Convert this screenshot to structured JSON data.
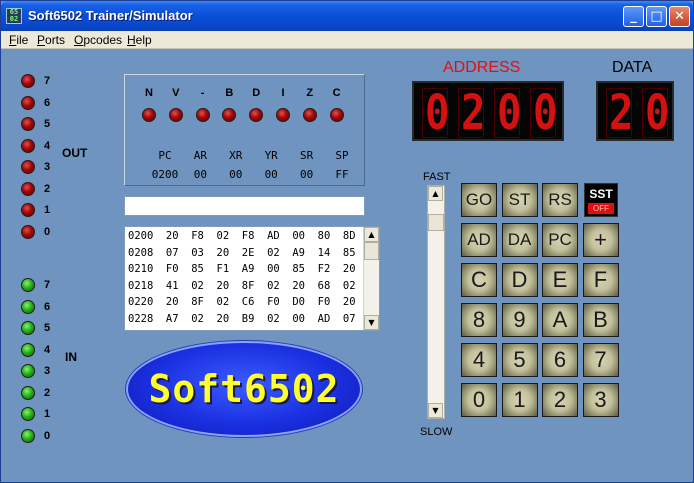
{
  "window": {
    "title": "Soft6502 Trainer/Simulator",
    "app_icon_text": "65 02"
  },
  "titlebar_buttons": {
    "minimize": "_",
    "maximize": "□",
    "close": "✕"
  },
  "menu": [
    "File",
    "Ports",
    "Opcodes",
    "Help"
  ],
  "out_port": {
    "label": "OUT",
    "bits": [
      "7",
      "6",
      "5",
      "4",
      "3",
      "2",
      "1",
      "0"
    ],
    "led_color": "#c01010"
  },
  "in_port": {
    "label": "IN",
    "bits": [
      "7",
      "6",
      "5",
      "4",
      "3",
      "2",
      "1",
      "0"
    ],
    "led_color": "#22b41a"
  },
  "flags": [
    "N",
    "V",
    "-",
    "B",
    "D",
    "I",
    "Z",
    "C"
  ],
  "registers": {
    "labels": [
      "PC",
      "AR",
      "XR",
      "YR",
      "SR",
      "SP"
    ],
    "values": [
      "0200",
      "00",
      "00",
      "00",
      "00",
      "FF"
    ]
  },
  "input_field": {
    "value": ""
  },
  "memory_dump": [
    "0200  20  F8  02  F8  AD  00  80  8D",
    "0208  07  03  20  2E  02  A9  14  85",
    "0210  F0  85  F1  A9  00  85  F2  20",
    "0218  41  02  20  8F  02  20  68  02",
    "0220  20  8F  02  C6  F0  D0  F0  20",
    "0228  A7  02  20  B9  02  00  AD  07"
  ],
  "scroll_arrows": {
    "up": "▲",
    "down": "▼"
  },
  "logo": {
    "text": "Soft6502"
  },
  "address_display": {
    "label": "ADDRESS",
    "digits": [
      "0",
      "2",
      "0",
      "0"
    ],
    "label_color": "#e01010"
  },
  "data_display": {
    "label": "DATA",
    "digits": [
      "2",
      "0"
    ],
    "label_color": "#000000"
  },
  "speed": {
    "top_label": "FAST",
    "bottom_label": "SLOW",
    "level": 0.07
  },
  "keypad": {
    "rows": [
      [
        "GO",
        "ST",
        "RS"
      ],
      [
        "AD",
        "DA",
        "PC",
        "+"
      ],
      [
        "C",
        "D",
        "E",
        "F"
      ],
      [
        "8",
        "9",
        "A",
        "B"
      ],
      [
        "4",
        "5",
        "6",
        "7"
      ],
      [
        "0",
        "1",
        "2",
        "3"
      ]
    ],
    "sst": {
      "label": "SST",
      "state": "OFF"
    }
  }
}
